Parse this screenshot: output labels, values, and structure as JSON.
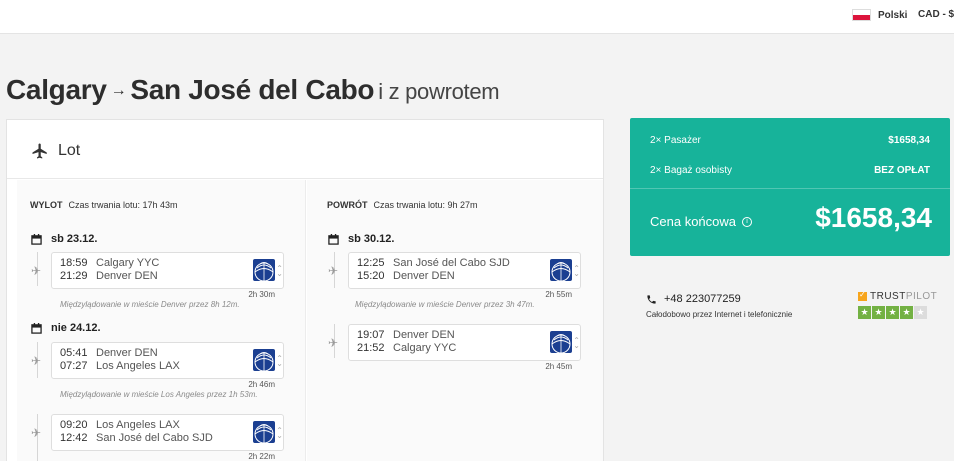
{
  "header": {
    "language": "Polski",
    "currency": "CAD - $"
  },
  "route": {
    "from": "Calgary",
    "arrow": "→",
    "to": "San José del Cabo",
    "trip_type": "i z powrotem"
  },
  "card": {
    "title": "Lot",
    "outbound": {
      "label": "WYLOT",
      "duration": "Czas trwania lotu: 17h 43m",
      "days": [
        {
          "date": "sb 23.12."
        },
        {
          "date": "nie 24.12."
        }
      ],
      "segments": [
        {
          "dep_time": "18:59",
          "dep_place": "Calgary YYC",
          "arr_time": "21:29",
          "arr_place": "Denver DEN",
          "duration": "2h 30m"
        },
        {
          "dep_time": "05:41",
          "dep_place": "Denver DEN",
          "arr_time": "07:27",
          "arr_place": "Los Angeles LAX",
          "duration": "2h 46m"
        },
        {
          "dep_time": "09:20",
          "dep_place": "Los Angeles LAX",
          "arr_time": "12:42",
          "arr_place": "San José del Cabo SJD",
          "duration": "2h 22m"
        }
      ],
      "layovers": [
        "Międzylądowanie w mieście Denver przez 8h 12m.",
        "Międzylądowanie w mieście Los Angeles przez 1h 53m."
      ]
    },
    "return": {
      "label": "POWRÓT",
      "duration": "Czas trwania lotu: 9h 27m",
      "days": [
        {
          "date": "sb 30.12."
        }
      ],
      "segments": [
        {
          "dep_time": "12:25",
          "dep_place": "San José del Cabo SJD",
          "arr_time": "15:20",
          "arr_place": "Denver DEN",
          "duration": "2h 55m"
        },
        {
          "dep_time": "19:07",
          "dep_place": "Denver DEN",
          "arr_time": "21:52",
          "arr_place": "Calgary YYC",
          "duration": "2h 45m"
        }
      ],
      "layovers": [
        "Międzylądowanie w mieście Denver przez 3h 47m."
      ]
    }
  },
  "price": {
    "passengers_label": "2× Pasażer",
    "passengers_value": "$1658,34",
    "bag_label": "2× Bagaż osobisty",
    "bag_value": "BEZ OPŁAT",
    "total_label": "Cena końcowa",
    "total_value": "$1658,34",
    "accent": "#17b39a"
  },
  "contact": {
    "phone": "+48 223077259",
    "hours": "Całodobowo przez Internet i telefonicznie"
  },
  "trustpilot": {
    "name_a": "TRUST",
    "name_b": "PILOT",
    "stars_filled": 4,
    "stars_total": 5
  }
}
